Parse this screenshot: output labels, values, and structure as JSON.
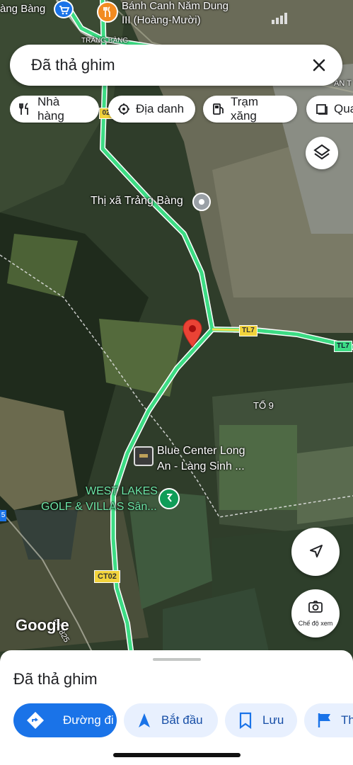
{
  "map": {
    "place_labels": {
      "top_left": "àng Bàng",
      "restaurant_line1": "Bánh Canh Năm Dung",
      "restaurant_line2": "III (Hoàng-Mười)",
      "road_trang_bang": "TRẢNG BÀNG",
      "top_right": "AN T",
      "road_ct02_top": "02",
      "town": "Thị xã Trảng Bàng",
      "road_tl7_a": "TL7",
      "road_tl7_b": "TL7",
      "to9": "TỔ 9",
      "blue_center_line1": "Blue Center Long",
      "blue_center_line2": "An - Làng Sinh ...",
      "golf_line1": "WEST LAKES",
      "golf_line2": "GOLF & VILLAS Sân...",
      "road_ct02": "CT02",
      "road_dt825": "ĐT 825",
      "left_edge": "5",
      "brand": "Google"
    }
  },
  "search": {
    "title": "Đã thả ghim",
    "close_icon": "close-icon"
  },
  "chips": [
    {
      "label": "Nhà hàng",
      "icon": "restaurant-icon"
    },
    {
      "label": "Địa danh",
      "icon": "landmark-icon"
    },
    {
      "label": "Trạm xăng",
      "icon": "gas-station-icon"
    },
    {
      "label": "Qua",
      "icon": "shopping-icon"
    }
  ],
  "controls": {
    "layers_icon": "layers-icon",
    "navigate_icon": "navigate-arrow-icon",
    "view_mode_label": "Chế độ xem"
  },
  "sheet": {
    "title": "Đã thả ghim",
    "buttons": [
      {
        "label": "Đường đi",
        "icon": "directions-icon"
      },
      {
        "label": "Bắt đầu",
        "icon": "navigation-icon"
      },
      {
        "label": "Lưu",
        "icon": "bookmark-icon"
      },
      {
        "label": "Th",
        "icon": "flag-icon"
      }
    ]
  },
  "colors": {
    "accent": "#1a73e8",
    "road": "#3ddc84",
    "pin": "#ea4335"
  }
}
